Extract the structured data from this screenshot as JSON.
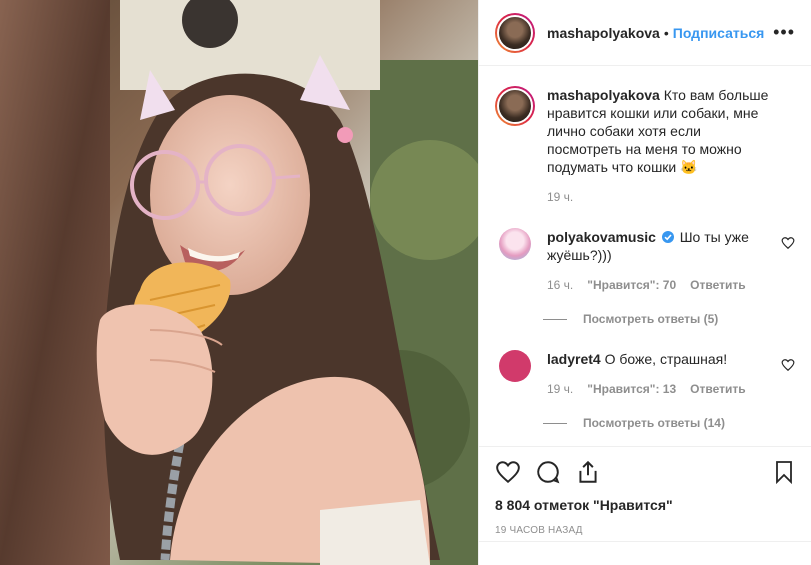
{
  "post": {
    "username": "mashapolyakova",
    "dot": "•",
    "follow_label": "Подписаться",
    "more_label": "•••"
  },
  "caption": {
    "username": "mashapolyakova",
    "text": "Кто вам больше нравится кошки или собаки, мне лично собаки хотя если посмотреть на меня то можно подумать что кошки 🐱",
    "time": "19 ч."
  },
  "comments": [
    {
      "username": "polyakovamusic",
      "verified": true,
      "text": "Шо ты уже жуёшь?)))",
      "time": "16 ч.",
      "likes": "\"Нравится\": 70",
      "reply_label": "Ответить",
      "view_replies": "Посмотреть ответы (5)",
      "avatar_color": "#f2c1d8"
    },
    {
      "username": "ladyret4",
      "verified": false,
      "text": "О боже, страшная!",
      "time": "19 ч.",
      "likes": "\"Нравится\": 13",
      "reply_label": "Ответить",
      "view_replies": "Посмотреть ответы (14)",
      "avatar_color": "#d13a6b"
    }
  ],
  "footer": {
    "likes_count": "8 804 отметок \"Нравится\"",
    "posted_ago": "19 ЧАСОВ НАЗАД"
  },
  "colors": {
    "link": "#3897f0",
    "muted": "#8e8e8e",
    "text": "#262626",
    "verified": "#3897f0"
  },
  "icons": [
    "heart-icon",
    "comment-icon",
    "share-icon",
    "bookmark-icon",
    "more-icon",
    "verified-icon"
  ]
}
